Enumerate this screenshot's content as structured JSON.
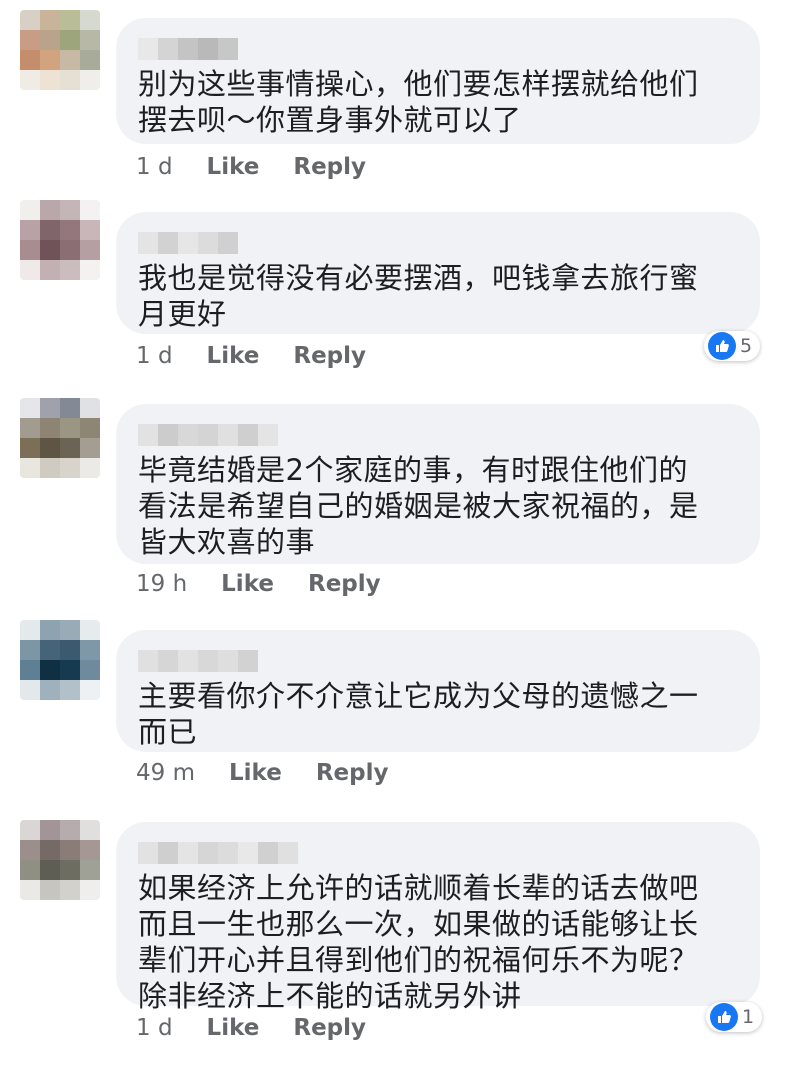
{
  "colors": {
    "bubble": "#f0f2f5",
    "text": "#1c1e21",
    "meta": "#65676b",
    "like": "#1877f2"
  },
  "comments": [
    {
      "text": "别为这些事情操心，他们要怎样摆就给他们\n摆去呗～你置身事外就可以了",
      "time": "1 d",
      "like": "Like",
      "reply": "Reply",
      "reactions": ""
    },
    {
      "text": "我也是觉得没有必要摆酒，吧钱拿去旅行蜜\n月更好",
      "time": "1 d",
      "like": "Like",
      "reply": "Reply",
      "reactions": "5"
    },
    {
      "text": "毕竟结婚是2个家庭的事，有时跟住他们的\n看法是希望自己的婚姻是被大家祝福的，是\n皆大欢喜的事",
      "time": "19 h",
      "like": "Like",
      "reply": "Reply",
      "reactions": ""
    },
    {
      "text": "主要看你介不介意让它成为父母的遗憾之一\n而已",
      "time": "49 m",
      "like": "Like",
      "reply": "Reply",
      "reactions": ""
    },
    {
      "text": "如果经济上允许的话就顺着长辈的话去做吧\n而且一生也那么一次，如果做的话能够让长\n辈们开心并且得到他们的祝福何乐不为呢？\n除非经济上不能的话就另外讲",
      "time": "1 d",
      "like": "Like",
      "reply": "Reply",
      "reactions": "1"
    }
  ]
}
